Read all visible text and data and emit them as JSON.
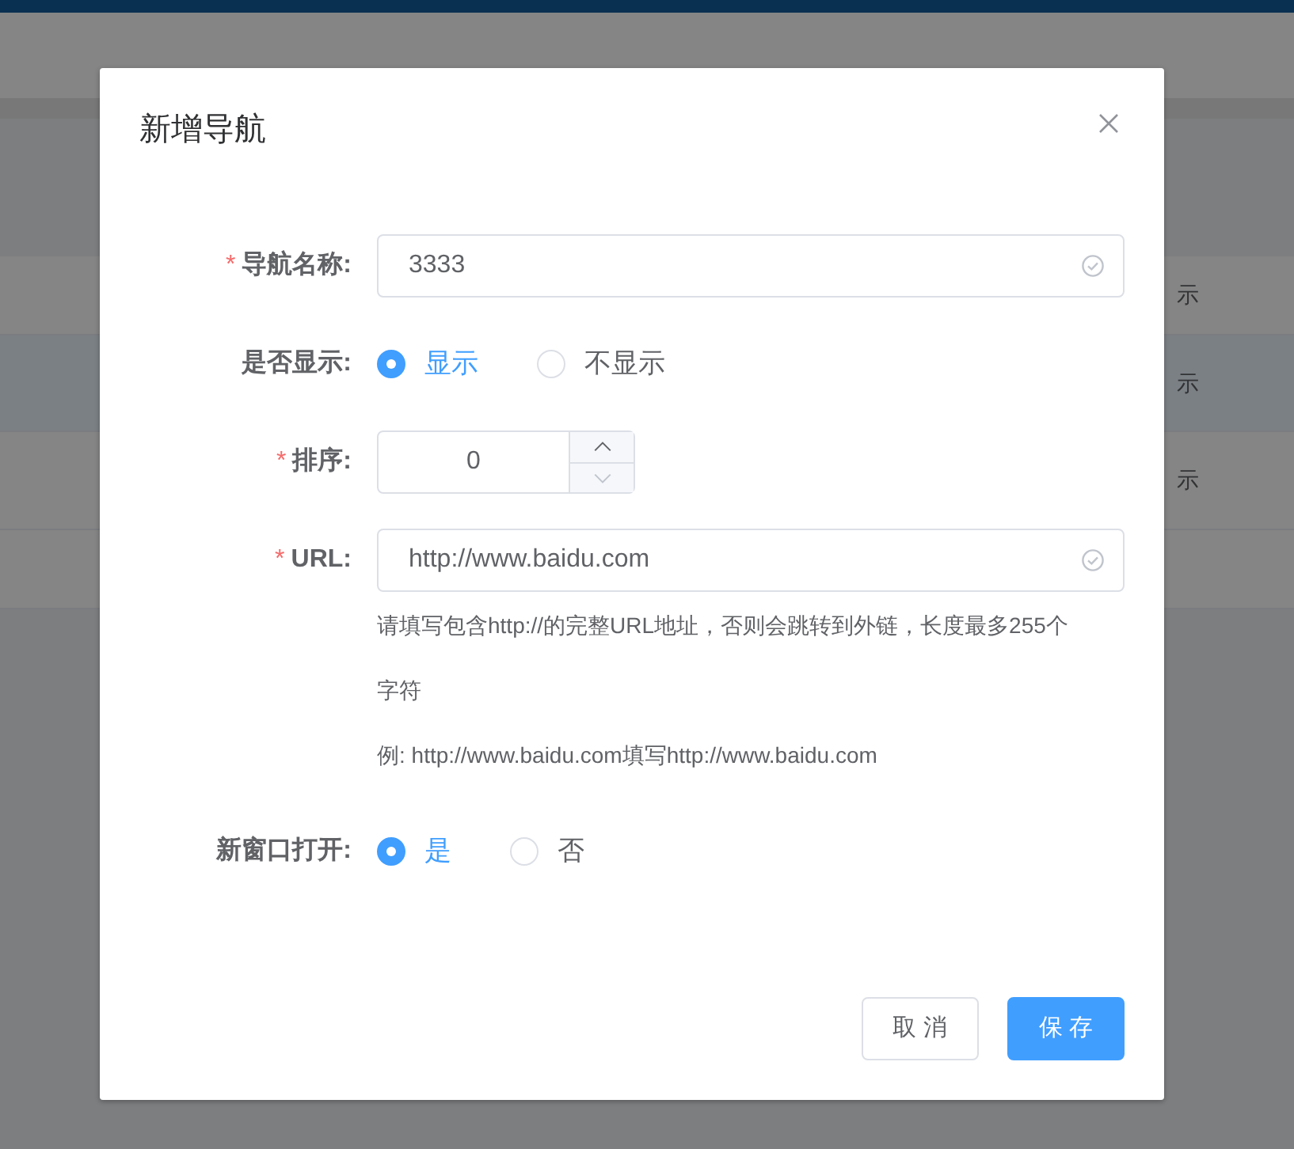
{
  "background": {
    "table_cells": [
      "示",
      "示",
      "示"
    ]
  },
  "dialog": {
    "title": "新增导航",
    "fields": [
      {
        "kind": "text",
        "mark": "*",
        "label": "导航名称:",
        "value": "3333",
        "valid": true
      },
      {
        "kind": "radio",
        "label": "是否显示:",
        "options": [
          {
            "label": "显示",
            "selected": true
          },
          {
            "label": "不显示",
            "selected": false
          }
        ]
      },
      {
        "kind": "number",
        "mark": "*",
        "label": "排序:",
        "value": "0"
      },
      {
        "kind": "text",
        "mark": "*",
        "label": "URL:",
        "value": "http://www.baidu.com",
        "valid": true,
        "help": [
          "请填写包含http://的完整URL地址，否则会跳转到外链，长度最多255个",
          "字符",
          "例: http://www.baidu.com填写http://www.baidu.com"
        ]
      },
      {
        "kind": "radio",
        "label": "新窗口打开:",
        "options": [
          {
            "label": "是",
            "selected": true
          },
          {
            "label": "否",
            "selected": false
          }
        ]
      }
    ],
    "buttons": [
      {
        "label": "取 消",
        "kind": "default"
      },
      {
        "label": "保 存",
        "kind": "primary"
      }
    ]
  }
}
